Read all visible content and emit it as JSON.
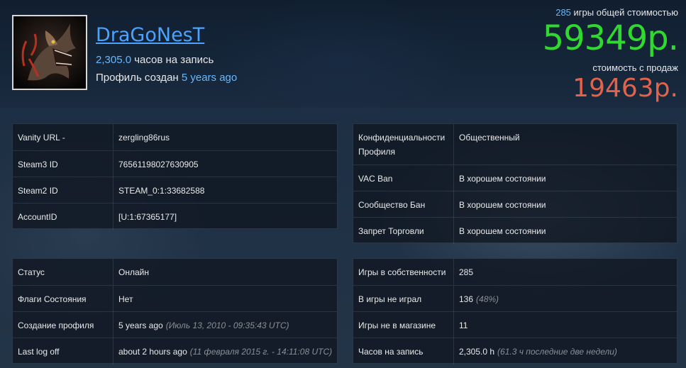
{
  "profile": {
    "username": "DraGoNesT",
    "hours_value": "2,305.0",
    "hours_suffix": " часов на запись",
    "created_prefix": "Профиль создан ",
    "created_value": "5 years ago"
  },
  "value": {
    "games_count": "285",
    "games_suffix": " игры общей стоимостью",
    "total": "59349р.",
    "sale_label": "стоимость с продаж",
    "sale_total": "19463р."
  },
  "ids_panel": [
    {
      "label": "Vanity URL -",
      "value": "zergling86rus"
    },
    {
      "label": "Steam3 ID",
      "value": "76561198027630905"
    },
    {
      "label": "Steam2 ID",
      "value": "STEAM_0:1:33682588"
    },
    {
      "label": "AccountID",
      "value": "[U:1:67365177]"
    }
  ],
  "status_panel": [
    {
      "label": "Конфиденциальности Профиля",
      "value": "Общественный"
    },
    {
      "label": "VAC Ban",
      "value": "В хорошем состоянии"
    },
    {
      "label": "Сообщество Бан",
      "value": "В хорошем состоянии"
    },
    {
      "label": "Запрет Торговли",
      "value": "В хорошем состоянии"
    }
  ],
  "state_panel": [
    {
      "label": "Статус",
      "value": "Онлайн",
      "note": ""
    },
    {
      "label": "Флаги Состояния",
      "value": "Нет",
      "note": ""
    },
    {
      "label": "Создание профиля",
      "value": "5 years ago",
      "note": "(Июль 13, 2010 - 09:35:43 UTC)"
    },
    {
      "label": "Last log off",
      "value": "about 2 hours ago",
      "note": "(11 февраля 2015 г. - 14:11:08 UTC)"
    }
  ],
  "games_panel": [
    {
      "label": "Игры в собственности",
      "value": "285",
      "note": ""
    },
    {
      "label": "В игры не играл",
      "value": "136",
      "note": "(48%)"
    },
    {
      "label": "Игры не в магазине",
      "value": "11",
      "note": ""
    },
    {
      "label": "Часов на запись",
      "value": "2,305.0 h",
      "note": "(61.3 ч последние две недели)"
    }
  ],
  "colors": {
    "link": "#4aa3ff",
    "total": "#2fd92f",
    "sale": "#e3624a"
  }
}
